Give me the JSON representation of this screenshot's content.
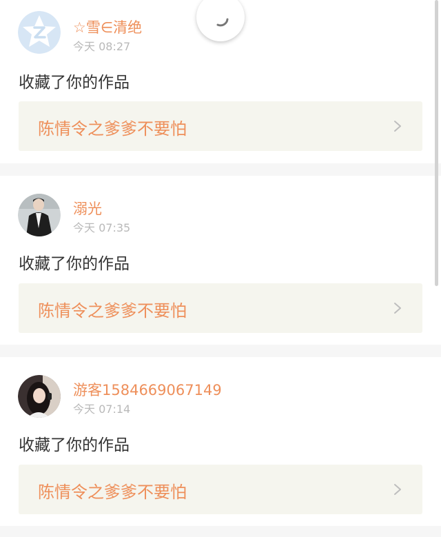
{
  "notifications": [
    {
      "username": "☆雪∈清绝",
      "time": "今天 08:27",
      "action": "收藏了你的作品",
      "work_title": "陈情令之爹爹不要怕",
      "avatar": "qq-default-avatar"
    },
    {
      "username": "溺光",
      "time": "今天 07:35",
      "action": "收藏了你的作品",
      "work_title": "陈情令之爹爹不要怕",
      "avatar": "person-in-suit-avatar"
    },
    {
      "username": "游客1584669067149",
      "time": "今天 07:14",
      "action": "收藏了你的作品",
      "work_title": "陈情令之爹爹不要怕",
      "avatar": "girl-photo-avatar"
    }
  ],
  "colors": {
    "accent": "#ee8f5a",
    "time": "#b9b9b9",
    "text": "#333333",
    "box": "#f5f5ee",
    "background": "#f6f6f6"
  },
  "icons": {
    "chevron": "chevron-right-icon",
    "refresh": "refresh-spinner-icon"
  }
}
